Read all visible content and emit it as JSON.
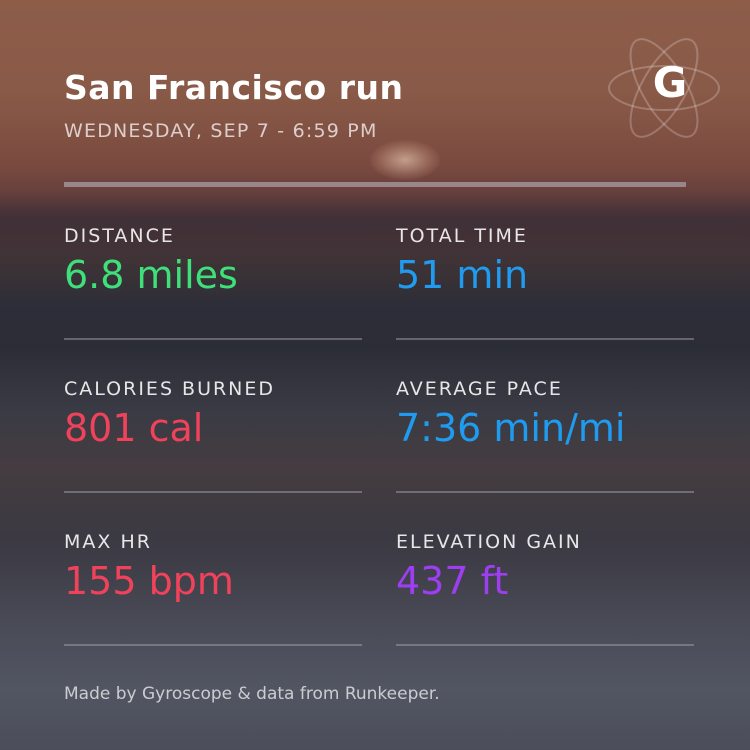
{
  "header": {
    "title": "San Francisco run",
    "subtitle": "WEDNESDAY, SEP 7 - 6:59 PM",
    "logo_letter": "G",
    "logo_icon": "atom-orbit-icon"
  },
  "stats": [
    {
      "label": "DISTANCE",
      "value": "6.8 miles",
      "color": "#3ee07a"
    },
    {
      "label": "TOTAL TIME",
      "value": "51 min",
      "color": "#1f9bf0"
    },
    {
      "label": "CALORIES BURNED",
      "value": "801 cal",
      "color": "#f0425a"
    },
    {
      "label": "AVERAGE PACE",
      "value": "7:36 min/mi",
      "color": "#1f9bf0"
    },
    {
      "label": "MAX HR",
      "value": "155 bpm",
      "color": "#f0425a"
    },
    {
      "label": "ELEVATION GAIN",
      "value": "437 ft",
      "color": "#9d3ef0"
    }
  ],
  "footer": {
    "text": "Made by Gyroscope & data from Runkeeper."
  }
}
